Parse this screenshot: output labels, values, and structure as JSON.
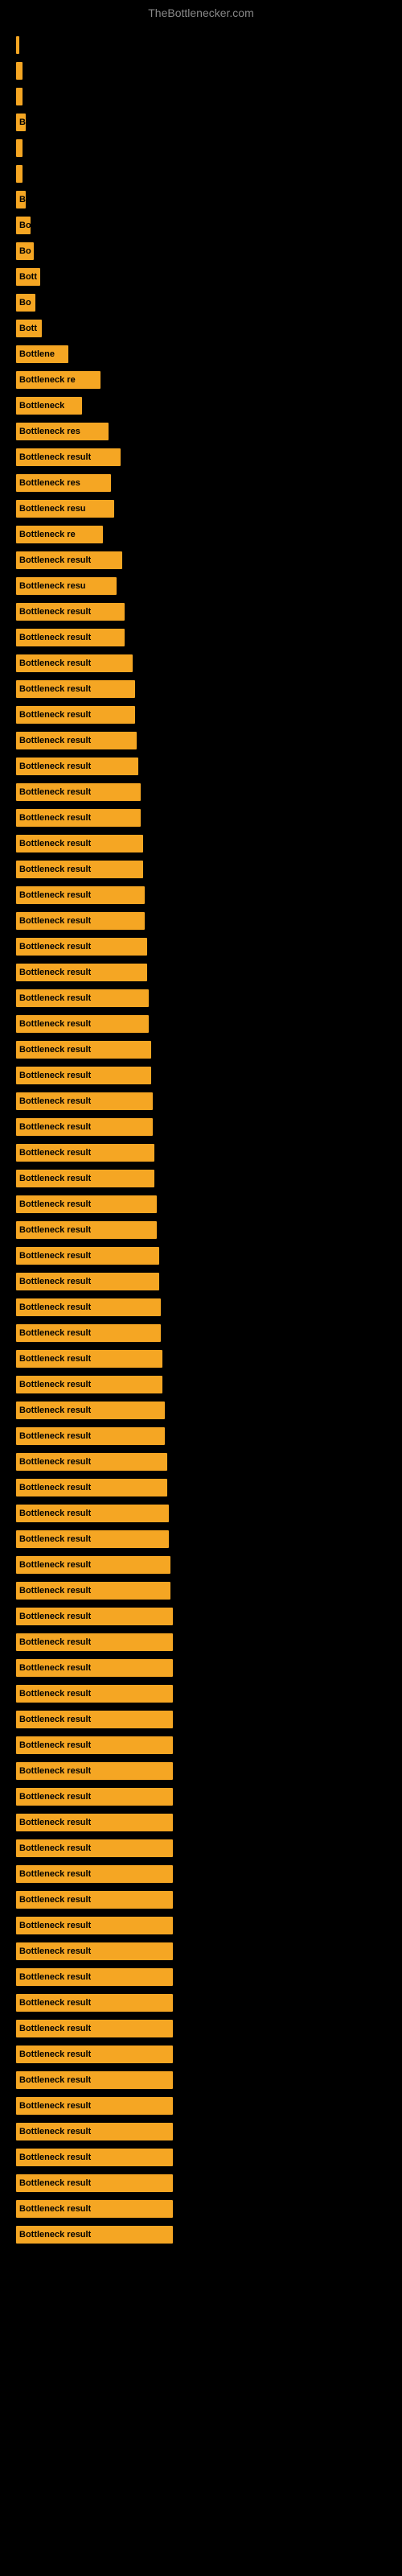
{
  "site": {
    "title": "TheBottlenecker.com"
  },
  "bars": [
    {
      "id": 1,
      "label": "",
      "width": 4
    },
    {
      "id": 2,
      "label": "",
      "width": 8
    },
    {
      "id": 3,
      "label": "",
      "width": 8
    },
    {
      "id": 4,
      "label": "B",
      "width": 12
    },
    {
      "id": 5,
      "label": "",
      "width": 8
    },
    {
      "id": 6,
      "label": "",
      "width": 8
    },
    {
      "id": 7,
      "label": "B",
      "width": 12
    },
    {
      "id": 8,
      "label": "Bo",
      "width": 18
    },
    {
      "id": 9,
      "label": "Bo",
      "width": 22
    },
    {
      "id": 10,
      "label": "Bott",
      "width": 30
    },
    {
      "id": 11,
      "label": "Bo",
      "width": 24
    },
    {
      "id": 12,
      "label": "Bott",
      "width": 32
    },
    {
      "id": 13,
      "label": "Bottlene",
      "width": 65
    },
    {
      "id": 14,
      "label": "Bottleneck re",
      "width": 105
    },
    {
      "id": 15,
      "label": "Bottleneck",
      "width": 82
    },
    {
      "id": 16,
      "label": "Bottleneck res",
      "width": 115
    },
    {
      "id": 17,
      "label": "Bottleneck result",
      "width": 130
    },
    {
      "id": 18,
      "label": "Bottleneck res",
      "width": 118
    },
    {
      "id": 19,
      "label": "Bottleneck resu",
      "width": 122
    },
    {
      "id": 20,
      "label": "Bottleneck re",
      "width": 108
    },
    {
      "id": 21,
      "label": "Bottleneck result",
      "width": 132
    },
    {
      "id": 22,
      "label": "Bottleneck resu",
      "width": 125
    },
    {
      "id": 23,
      "label": "Bottleneck result",
      "width": 135
    },
    {
      "id": 24,
      "label": "Bottleneck result",
      "width": 135
    },
    {
      "id": 25,
      "label": "Bottleneck result",
      "width": 145
    },
    {
      "id": 26,
      "label": "Bottleneck result",
      "width": 148
    },
    {
      "id": 27,
      "label": "Bottleneck result",
      "width": 148
    },
    {
      "id": 28,
      "label": "Bottleneck result",
      "width": 150
    },
    {
      "id": 29,
      "label": "Bottleneck result",
      "width": 152
    },
    {
      "id": 30,
      "label": "Bottleneck result",
      "width": 155
    },
    {
      "id": 31,
      "label": "Bottleneck result",
      "width": 155
    },
    {
      "id": 32,
      "label": "Bottleneck result",
      "width": 158
    },
    {
      "id": 33,
      "label": "Bottleneck result",
      "width": 158
    },
    {
      "id": 34,
      "label": "Bottleneck result",
      "width": 160
    },
    {
      "id": 35,
      "label": "Bottleneck result",
      "width": 160
    },
    {
      "id": 36,
      "label": "Bottleneck result",
      "width": 163
    },
    {
      "id": 37,
      "label": "Bottleneck result",
      "width": 163
    },
    {
      "id": 38,
      "label": "Bottleneck result",
      "width": 165
    },
    {
      "id": 39,
      "label": "Bottleneck result",
      "width": 165
    },
    {
      "id": 40,
      "label": "Bottleneck result",
      "width": 168
    },
    {
      "id": 41,
      "label": "Bottleneck result",
      "width": 168
    },
    {
      "id": 42,
      "label": "Bottleneck result",
      "width": 170
    },
    {
      "id": 43,
      "label": "Bottleneck result",
      "width": 170
    },
    {
      "id": 44,
      "label": "Bottleneck result",
      "width": 172
    },
    {
      "id": 45,
      "label": "Bottleneck result",
      "width": 172
    },
    {
      "id": 46,
      "label": "Bottleneck result",
      "width": 175
    },
    {
      "id": 47,
      "label": "Bottleneck result",
      "width": 175
    },
    {
      "id": 48,
      "label": "Bottleneck result",
      "width": 178
    },
    {
      "id": 49,
      "label": "Bottleneck result",
      "width": 178
    },
    {
      "id": 50,
      "label": "Bottleneck result",
      "width": 180
    },
    {
      "id": 51,
      "label": "Bottleneck result",
      "width": 180
    },
    {
      "id": 52,
      "label": "Bottleneck result",
      "width": 182
    },
    {
      "id": 53,
      "label": "Bottleneck result",
      "width": 182
    },
    {
      "id": 54,
      "label": "Bottleneck result",
      "width": 185
    },
    {
      "id": 55,
      "label": "Bottleneck result",
      "width": 185
    },
    {
      "id": 56,
      "label": "Bottleneck result",
      "width": 188
    },
    {
      "id": 57,
      "label": "Bottleneck result",
      "width": 188
    },
    {
      "id": 58,
      "label": "Bottleneck result",
      "width": 190
    },
    {
      "id": 59,
      "label": "Bottleneck result",
      "width": 190
    },
    {
      "id": 60,
      "label": "Bottleneck result",
      "width": 192
    },
    {
      "id": 61,
      "label": "Bottleneck result",
      "width": 192
    },
    {
      "id": 62,
      "label": "Bottleneck result",
      "width": 195
    },
    {
      "id": 63,
      "label": "Bottleneck result",
      "width": 195
    },
    {
      "id": 64,
      "label": "Bottleneck result",
      "width": 195
    },
    {
      "id": 65,
      "label": "Bottleneck result",
      "width": 195
    },
    {
      "id": 66,
      "label": "Bottleneck result",
      "width": 195
    },
    {
      "id": 67,
      "label": "Bottleneck result",
      "width": 195
    },
    {
      "id": 68,
      "label": "Bottleneck result",
      "width": 195
    },
    {
      "id": 69,
      "label": "Bottleneck result",
      "width": 195
    },
    {
      "id": 70,
      "label": "Bottleneck result",
      "width": 195
    },
    {
      "id": 71,
      "label": "Bottleneck result",
      "width": 195
    },
    {
      "id": 72,
      "label": "Bottleneck result",
      "width": 195
    },
    {
      "id": 73,
      "label": "Bottleneck result",
      "width": 195
    },
    {
      "id": 74,
      "label": "Bottleneck result",
      "width": 195
    },
    {
      "id": 75,
      "label": "Bottleneck result",
      "width": 195
    },
    {
      "id": 76,
      "label": "Bottleneck result",
      "width": 195
    },
    {
      "id": 77,
      "label": "Bottleneck result",
      "width": 195
    },
    {
      "id": 78,
      "label": "Bottleneck result",
      "width": 195
    },
    {
      "id": 79,
      "label": "Bottleneck result",
      "width": 195
    },
    {
      "id": 80,
      "label": "Bottleneck result",
      "width": 195
    },
    {
      "id": 81,
      "label": "Bottleneck result",
      "width": 195
    },
    {
      "id": 82,
      "label": "Bottleneck result",
      "width": 195
    },
    {
      "id": 83,
      "label": "Bottleneck result",
      "width": 195
    },
    {
      "id": 84,
      "label": "Bottleneck result",
      "width": 195
    },
    {
      "id": 85,
      "label": "Bottleneck result",
      "width": 195
    },
    {
      "id": 86,
      "label": "Bottleneck result",
      "width": 195
    }
  ]
}
